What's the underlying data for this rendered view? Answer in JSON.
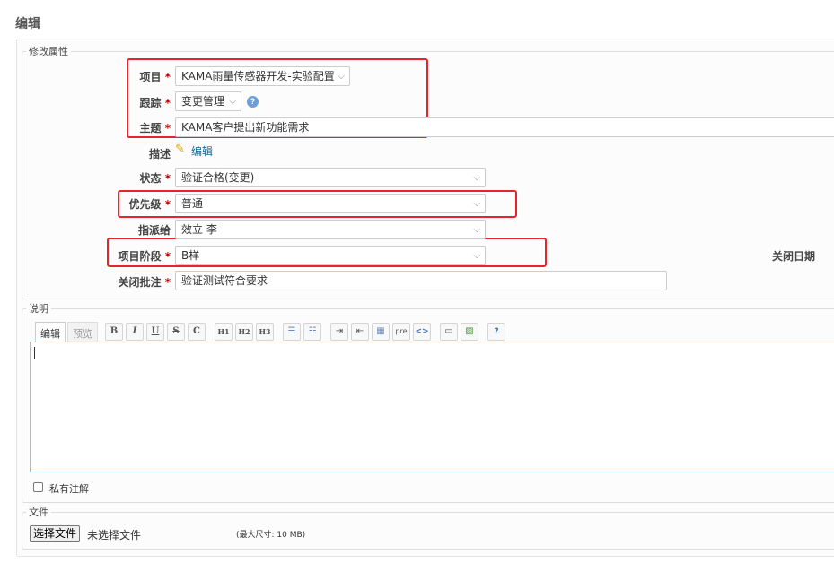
{
  "page": {
    "title": "编辑"
  },
  "attributes": {
    "legend": "修改属性",
    "project": {
      "label": "项目",
      "value": "KAMA雨量传感器开发-实验配置"
    },
    "tracker": {
      "label": "跟踪",
      "value": "变更管理"
    },
    "subject": {
      "label": "主题",
      "value": "KAMA客户提出新功能需求"
    },
    "description": {
      "label": "描述",
      "edit_label": "编辑"
    },
    "status": {
      "label": "状态",
      "value": "验证合格(变更)"
    },
    "priority": {
      "label": "优先级",
      "value": "普通"
    },
    "assignee": {
      "label": "指派给",
      "value": "效立 李"
    },
    "stage": {
      "label": "项目阶段",
      "value": "B样"
    },
    "close_date": {
      "label": "关闭日期"
    },
    "close_note": {
      "label": "关闭批注",
      "value": "验证测试符合要求"
    },
    "required_mark": "*"
  },
  "notes": {
    "legend": "说明",
    "tab_edit": "编辑",
    "tab_preview": "预览",
    "toolbar": {
      "bold": "B",
      "italic": "I",
      "underline": "U",
      "strike": "S",
      "code": "C",
      "h1": "H1",
      "h2": "H2",
      "h3": "H3",
      "pre": "pre",
      "link": "<>",
      "help": "?"
    },
    "private_notes_label": "私有注解"
  },
  "files": {
    "legend": "文件",
    "choose_button": "选择文件",
    "no_file": "未选择文件",
    "max_size": "(最大尺寸: 10 MB)"
  },
  "colors": {
    "highlight": "#e8232b",
    "required": "#bb0000",
    "link": "#116699"
  }
}
